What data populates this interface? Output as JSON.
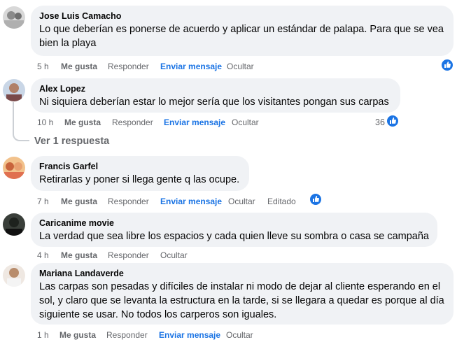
{
  "comments": [
    {
      "author": "Jose Luis Camacho",
      "text": "Lo que deberían es ponerse de acuerdo y aplicar un estándar de palapa. Para que se vea bien la playa",
      "time": "5 h",
      "like": "Me gusta",
      "reply": "Responder",
      "message": "Enviar mensaje",
      "hide": "Ocultar"
    },
    {
      "author": "Alex Lopez",
      "text": "Ni siquiera deberían estar lo mejor sería que los visitantes pongan sus carpas",
      "time": "10 h",
      "like": "Me gusta",
      "reply": "Responder",
      "message": "Enviar mensaje",
      "hide": "Ocultar",
      "reactions": "36",
      "view_replies": "Ver 1 respuesta"
    },
    {
      "author": "Francis Garfel",
      "text": "Retirarlas y poner si llega gente q las ocupe.",
      "time": "7 h",
      "like": "Me gusta",
      "reply": "Responder",
      "message": "Enviar mensaje",
      "hide": "Ocultar",
      "edited": "Editado"
    },
    {
      "author": "Caricanime movie",
      "text": "La verdad que sea libre los espacios y cada quien lleve su sombra o casa se campaña",
      "time": "4 h",
      "like": "Me gusta",
      "reply": "Responder",
      "hide": "Ocultar"
    },
    {
      "author": "Mariana Landaverde",
      "text": "Las carpas son pesadas y difíciles de instalar ni modo de dejar al cliente esperando en el sol, y claro que se levanta la estructura en la tarde, si se llegara a quedar es porque al día siguiente se usar. No todos los carperos son iguales.",
      "time": "1 h",
      "like": "Me gusta",
      "reply": "Responder",
      "message": "Enviar mensaje",
      "hide": "Ocultar"
    }
  ],
  "colors": {
    "bubble": "#f0f2f5",
    "meta": "#65676b",
    "link": "#1b74e4"
  },
  "icons": {
    "like_badge": "like-badge-icon"
  }
}
